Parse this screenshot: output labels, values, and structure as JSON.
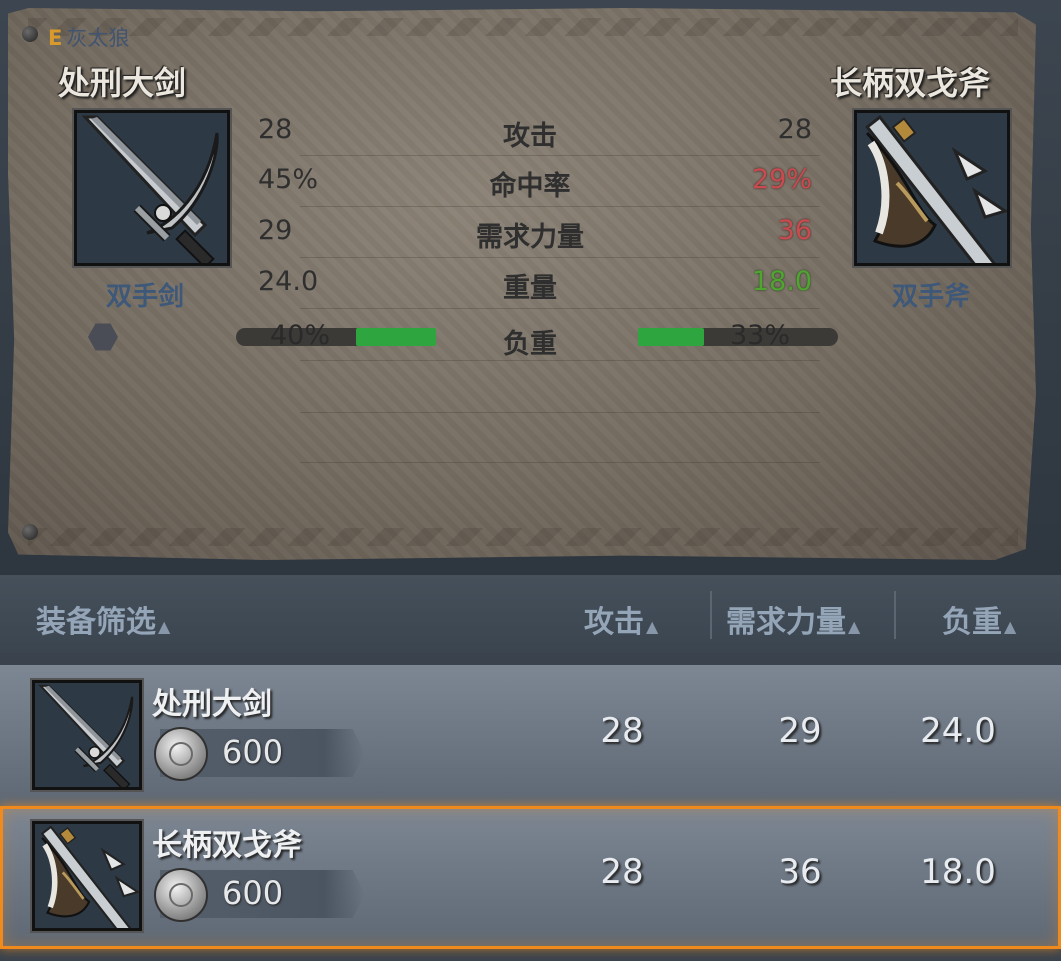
{
  "comparison": {
    "owner_key": "E",
    "owner_name": "灰太狼",
    "left": {
      "name": "处刑大剑",
      "type": "双手剑",
      "icon": "greatsword-icon"
    },
    "right": {
      "name": "长柄双戈斧",
      "type": "双手斧",
      "icon": "halberd-axe-icon"
    },
    "stats": [
      {
        "label": "攻击",
        "left": "28",
        "right": "28",
        "right_color": "neutral"
      },
      {
        "label": "命中率",
        "left": "45%",
        "right": "29%",
        "right_color": "red"
      },
      {
        "label": "需求力量",
        "left": "29",
        "right": "36",
        "right_color": "red"
      },
      {
        "label": "重量",
        "left": "24.0",
        "right": "18.0",
        "right_color": "green"
      }
    ],
    "load": {
      "label": "负重",
      "left": "40%",
      "right": "33%",
      "left_fraction": 0.4,
      "right_fraction": 0.33
    }
  },
  "list": {
    "headers": {
      "filter": "装备筛选",
      "attack": "攻击",
      "strength": "需求力量",
      "weight": "负重"
    },
    "items": [
      {
        "name": "处刑大剑",
        "price": "600",
        "attack": "28",
        "strength": "29",
        "weight": "24.0",
        "selected": false,
        "icon": "greatsword-icon"
      },
      {
        "name": "长柄双戈斧",
        "price": "600",
        "attack": "28",
        "strength": "36",
        "weight": "18.0",
        "selected": true,
        "icon": "halberd-axe-icon"
      }
    ]
  },
  "colors": {
    "highlight": "#f08a1c",
    "worse": "#c94a4f",
    "better": "#4fa52f"
  }
}
